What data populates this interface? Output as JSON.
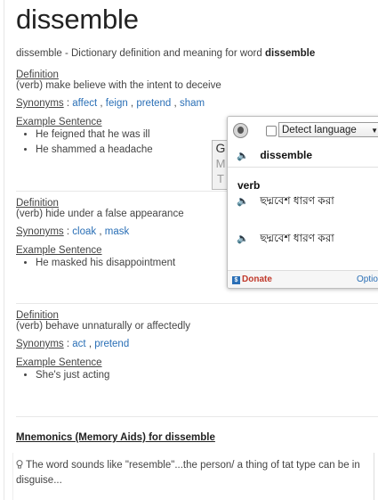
{
  "word": "dissemble",
  "intro": {
    "prefix": "dissemble - Dictionary definition and meaning for word",
    "word": "dissemble"
  },
  "labels": {
    "definition": "Definition",
    "synonyms": "Synonyms",
    "example": "Example Sentence"
  },
  "senses": [
    {
      "definition": "(verb) make believe with the intent to deceive",
      "synonyms": [
        "affect",
        "feign",
        "pretend",
        "sham"
      ],
      "examples": [
        "He feigned that he was ill",
        "He shammed a headache"
      ]
    },
    {
      "definition": "(verb) hide under a false appearance",
      "synonyms": [
        "cloak",
        "mask"
      ],
      "examples": [
        "He masked his disappointment"
      ]
    },
    {
      "definition": "(verb) behave unnaturally or affectedly",
      "synonyms": [
        "act",
        "pretend"
      ],
      "examples": [
        "She's just acting"
      ]
    }
  ],
  "mnemonics": {
    "title": "Mnemonics (Memory Aids) for dissemble",
    "text": "The word sounds like \"resemble\"...the person/ a thing of tat type can be in disguise..."
  },
  "popup": {
    "detect_language": "Detect language",
    "word": "dissemble",
    "pos": "verb",
    "translations": [
      "ছদ্মবেশ ধারণ করা",
      "ছদ্মবেশ ধারণ করা"
    ],
    "donate": "Donate",
    "options": "Options"
  },
  "gmt_tab": {
    "g": "G",
    "m": "M",
    "t": "T"
  },
  "colors": {
    "link": "#2a6fb6",
    "donate": "#c0392b"
  }
}
